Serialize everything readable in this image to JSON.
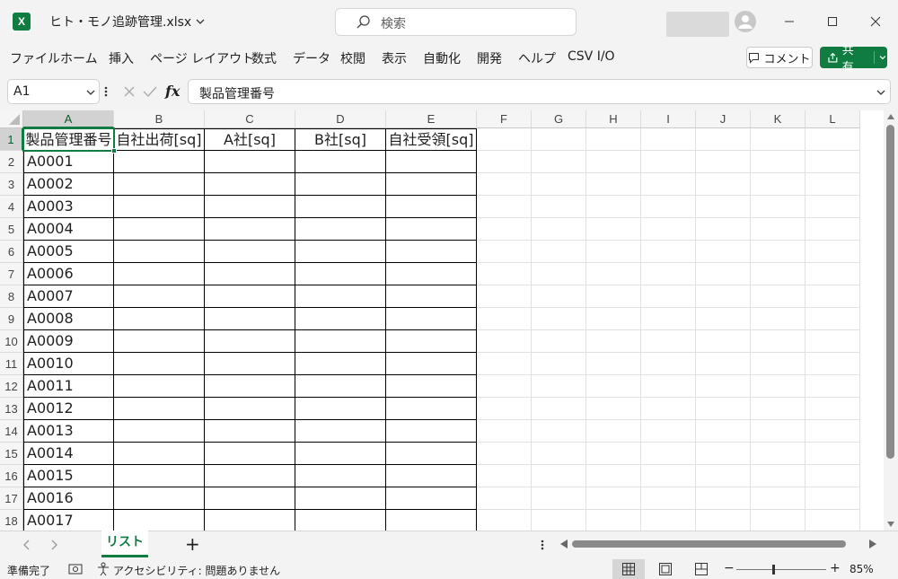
{
  "titlebar": {
    "file_name": "ヒト・モノ追跡管理.xlsx",
    "app_icon_letter": "X"
  },
  "search": {
    "placeholder": "検索"
  },
  "window_controls": [
    "minimize",
    "maximize",
    "close"
  ],
  "menu": {
    "items": [
      "ファイル",
      "ホーム",
      "挿入",
      "ページ レイアウト",
      "数式",
      "データ",
      "校閲",
      "表示",
      "自動化",
      "開発",
      "ヘルプ",
      "CSV I/O"
    ]
  },
  "actions": {
    "comment": "コメント",
    "share": "共有"
  },
  "formula_bar": {
    "name_box": "A1",
    "formula": "製品管理番号",
    "fx": "fx"
  },
  "columns": [
    "A",
    "B",
    "C",
    "D",
    "E",
    "F",
    "G",
    "H",
    "I",
    "J",
    "K",
    "L"
  ],
  "rows": [
    "1",
    "2",
    "3",
    "4",
    "5",
    "6",
    "7",
    "8",
    "9",
    "10",
    "11",
    "12",
    "13",
    "14",
    "15",
    "16",
    "17",
    "18"
  ],
  "table": {
    "headers": [
      "製品管理番号",
      "自社出荷[sq]",
      "A社[sq]",
      "B社[sq]",
      "自社受領[sq]"
    ],
    "ids": [
      "A0001",
      "A0002",
      "A0003",
      "A0004",
      "A0005",
      "A0006",
      "A0007",
      "A0008",
      "A0009",
      "A0010",
      "A0011",
      "A0012",
      "A0013",
      "A0014",
      "A0015",
      "A0016",
      "A0017"
    ]
  },
  "sheet_tabs": {
    "active": "リスト",
    "add": "+"
  },
  "status": {
    "ready": "準備完了",
    "accessibility": "アクセシビリティ: 問題ありません",
    "zoom": "85%"
  },
  "colors": {
    "accent": "#107c41"
  }
}
